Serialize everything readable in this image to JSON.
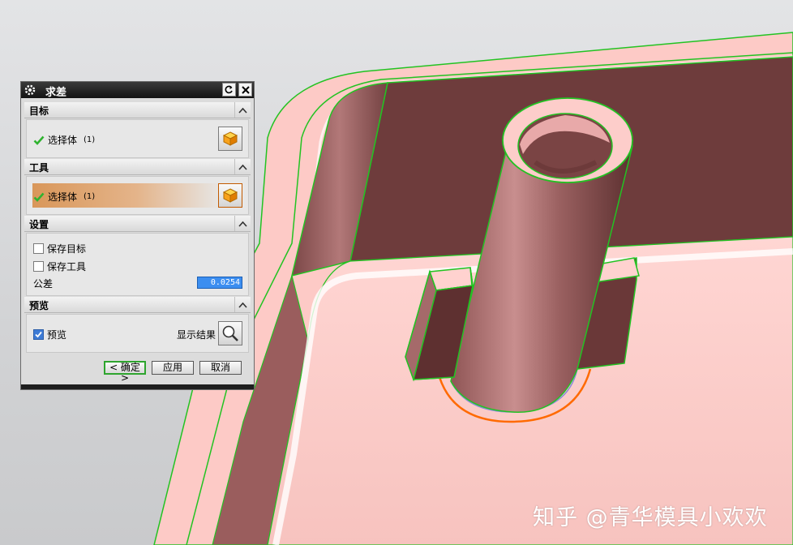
{
  "dialog": {
    "title": "求差",
    "sections": {
      "target": {
        "header": "目标",
        "select_label": "选择体",
        "select_count": "(1)"
      },
      "tool": {
        "header": "工具",
        "select_label": "选择体",
        "select_count": "(1)"
      },
      "settings": {
        "header": "设置",
        "keep_target_label": "保存目标",
        "keep_tool_label": "保存工具",
        "tolerance_label": "公差",
        "tolerance_value": "0.0254"
      },
      "preview": {
        "header": "预览",
        "preview_label": "预览",
        "show_result_label": "显示结果"
      }
    },
    "buttons": {
      "ok": "< 确定 >",
      "apply": "应用",
      "cancel": "取消"
    },
    "state": {
      "keep_target_checked": false,
      "keep_tool_checked": false,
      "preview_checked": true
    }
  },
  "watermark": "知乎 @青华模具小欢欢",
  "colors": {
    "part_face": "#f7c9c6",
    "part_inner": "#6e3c3c",
    "edge_green": "#22c322",
    "highlight_orange": "#ff6a00",
    "accent_blue": "#3c8ef0"
  },
  "icons": [
    "gear-icon",
    "reset-icon",
    "close-icon",
    "chevron-up-icon",
    "check-icon",
    "cube-icon",
    "magnifier-icon"
  ]
}
